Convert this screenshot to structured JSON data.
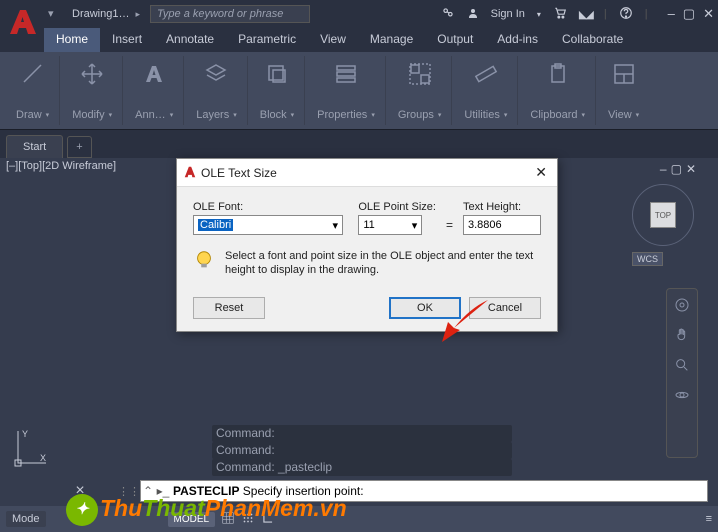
{
  "titlebar": {
    "doc": "Drawing1…",
    "search_placeholder": "Type a keyword or phrase",
    "signin": "Sign In"
  },
  "menu": {
    "tabs": [
      "Home",
      "Insert",
      "Annotate",
      "Parametric",
      "View",
      "Manage",
      "Output",
      "Add-ins",
      "Collaborate"
    ]
  },
  "ribbon": {
    "panels": [
      "Draw",
      "Modify",
      "Ann…",
      "Layers",
      "Block",
      "Properties",
      "Groups",
      "Utilities",
      "Clipboard",
      "View"
    ]
  },
  "filetab": {
    "name": "Start"
  },
  "viewport": {
    "label": "[–][Top][2D Wireframe]",
    "viewcube": "TOP",
    "wcs": "WCS"
  },
  "command_history": [
    "Command:",
    "Command:",
    "Command: _pasteclip"
  ],
  "commandline": {
    "cmd": "PASTECLIP",
    "prompt": "Specify insertion point:"
  },
  "dialog": {
    "title": "OLE Text Size",
    "font_label": "OLE Font:",
    "font_value": "Calibri",
    "size_label": "OLE Point Size:",
    "size_value": "11",
    "height_label": "Text Height:",
    "height_value": "3.8806",
    "hint": "Select a font and point size in the OLE object and enter the text height to display in the drawing.",
    "reset": "Reset",
    "ok": "OK",
    "cancel": "Cancel"
  },
  "status": {
    "mode_left": "Mode",
    "model": "MODEL"
  },
  "watermark": {
    "p1": "Thu",
    "p2": "Thuat",
    "p3": "PhanMem",
    "p4": ".vn"
  }
}
